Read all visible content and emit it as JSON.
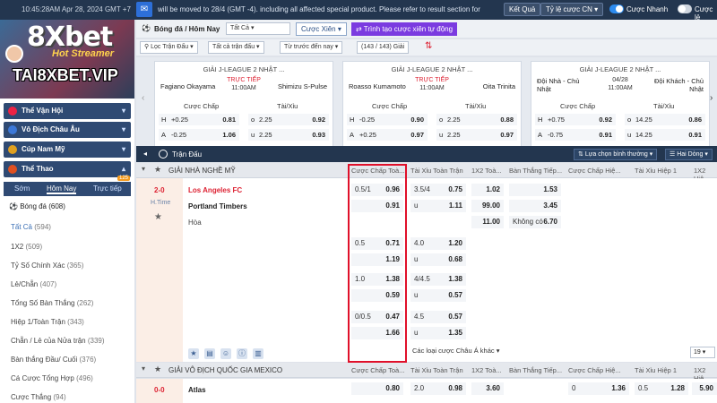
{
  "topbar": {
    "datetime": "10:45:28AM Apr 28, 2024 GMT +7",
    "ticker": "will be moved to 28/4 (GMT -4). including all affected special product. Please refer to result section for",
    "results_button": "Kết Quả",
    "odds_type": "Tỷ lệ cược CN",
    "fast_bet": "Cược Nhanh",
    "single_bet": "Cược lẻ"
  },
  "logo": {
    "brand": "8Xbet",
    "hot": "Hot Streamer",
    "site": "TAI8XBET.VIP"
  },
  "sidebar": {
    "headers": [
      {
        "label": "Thể Vận Hội"
      },
      {
        "label": "Vô Địch Châu Âu"
      },
      {
        "label": "Cúp Nam Mỹ"
      },
      {
        "label": "Thể Thao"
      }
    ],
    "tabs": [
      "Sớm",
      "Hôm Nay",
      "Trực tiếp"
    ],
    "live_count": "125",
    "sport": "Bóng đá (608)",
    "items": [
      {
        "label": "Tất Cả",
        "count": "(594)"
      },
      {
        "label": "1X2",
        "count": "(509)"
      },
      {
        "label": "Tỷ Số Chính Xác",
        "count": "(365)"
      },
      {
        "label": "Lẻ/Chẵn",
        "count": "(407)"
      },
      {
        "label": "Tổng Số Bàn Thắng",
        "count": "(262)"
      },
      {
        "label": "Hiệp 1/Toàn Trận",
        "count": "(343)"
      },
      {
        "label": "Chẵn / Lẻ của Nửa trận",
        "count": "(339)"
      },
      {
        "label": "Bàn thắng Đầu/ Cuối",
        "count": "(376)"
      },
      {
        "label": "Cá Cược Tổng Hợp",
        "count": "(496)"
      },
      {
        "label": "Cược Thắng",
        "count": "(94)"
      }
    ]
  },
  "main": {
    "title": "Bóng đá / Hôm Nay",
    "filter_all": "Tất Cả",
    "xien_button": "Cược Xiên",
    "create_button": "Trình tạo cược xiên tự động",
    "filters": [
      "Lọc Trận Đấu",
      "Tất cả trận đấu",
      "Từ trước đến nay"
    ],
    "count": "(143 / 143) Giải"
  },
  "cards": [
    {
      "league": "GIẢI J-LEAGUE 2 NHẬT ...",
      "home": "Fagiano Okayama",
      "away": "Shimizu S-Pulse",
      "status": "TRỰC TIẾP",
      "time": "11:00AM",
      "h1": "Cược Chấp",
      "h2": "Tài/Xỉu",
      "r1": [
        "H",
        "+0.25",
        "0.81",
        "o",
        "2.25",
        "0.92"
      ],
      "r2": [
        "A",
        "-0.25",
        "1.06",
        "u",
        "2.25",
        "0.93"
      ]
    },
    {
      "league": "GIẢI J-LEAGUE 2 NHẬT ...",
      "home": "Roasso Kumamoto",
      "away": "Oita Trinita",
      "status": "TRỰC TIẾP",
      "time": "11:00AM",
      "h1": "Cược Chấp",
      "h2": "Tài/Xỉu",
      "r1": [
        "H",
        "-0.25",
        "0.90",
        "o",
        "2.25",
        "0.88"
      ],
      "r2": [
        "A",
        "+0.25",
        "0.97",
        "u",
        "2.25",
        "0.97"
      ]
    },
    {
      "league": "GIẢI J-LEAGUE 2 NHẬT ...",
      "home": "Đội Nhà - Chủ Nhật",
      "away": "Đội Khách - Chủ Nhật",
      "status": "04/28",
      "time": "11:00AM",
      "h1": "Cược Chấp",
      "h2": "Tài/Xỉu",
      "r1": [
        "H",
        "+0.75",
        "0.92",
        "o",
        "14.25",
        "0.86"
      ],
      "r2": [
        "A",
        "-0.75",
        "0.91",
        "u",
        "14.25",
        "0.91"
      ]
    }
  ],
  "section": {
    "label": "Trận Đấu",
    "sort": "Lựa chọn bình thường",
    "lines": "Hai Dòng"
  },
  "league1": {
    "name": "GIẢI NHÀ NGHỀ MỸ",
    "cols": [
      "Cược Chấp Toà...",
      "Tài Xỉu Toàn Trận",
      "1X2 Toà...",
      "Bàn Thắng Tiếp...",
      "Cược Chấp Hiệ...",
      "Tài Xỉu Hiệp 1",
      "1X2 Hiệ"
    ]
  },
  "match1": {
    "score": "2-0",
    "half": "H.Time",
    "home": "Los Angeles FC",
    "away": "Portland Timbers",
    "draw": "Hòa",
    "handicap": [
      [
        "0.5/1",
        "0.96"
      ],
      [
        "",
        "0.91"
      ],
      [
        "0.5",
        "0.71"
      ],
      [
        "",
        "1.19"
      ],
      [
        "1.0",
        "1.38"
      ],
      [
        "",
        "0.59"
      ],
      [
        "0/0.5",
        "0.47"
      ],
      [
        "",
        "1.66"
      ]
    ],
    "overunder": [
      [
        "3.5/4",
        "0.75"
      ],
      [
        "u",
        "1.11"
      ],
      [
        "4.0",
        "1.20"
      ],
      [
        "u",
        "0.68"
      ],
      [
        "4/4.5",
        "1.38"
      ],
      [
        "u",
        "0.57"
      ],
      [
        "4.5",
        "0.57"
      ],
      [
        "u",
        "1.35"
      ]
    ],
    "x12": [
      "1.02",
      "99.00",
      "11.00"
    ],
    "nextgoal": [
      "1.53",
      "3.45",
      "6.70"
    ],
    "nogoal": "Không có",
    "more_types": "Các loại cược Châu Á khác",
    "page": "19"
  },
  "league2": {
    "name": "GIẢI VÔ ĐỊCH QUỐC GIA MEXICO",
    "cols": [
      "Cược Chấp Toà...",
      "Tài Xỉu Toàn Trận",
      "1X2 Toà...",
      "Bàn Thắng Tiếp...",
      "Cược Chấp Hiệ...",
      "Tài Xỉu Hiệp 1",
      "1X2 Hiệ"
    ]
  },
  "match2": {
    "score": "0-0",
    "home": "Atlas",
    "odds": [
      "0.80",
      "2.0",
      "0.98",
      "3.60",
      "0",
      "1.36",
      "0.5",
      "1.28",
      "5.90"
    ]
  }
}
